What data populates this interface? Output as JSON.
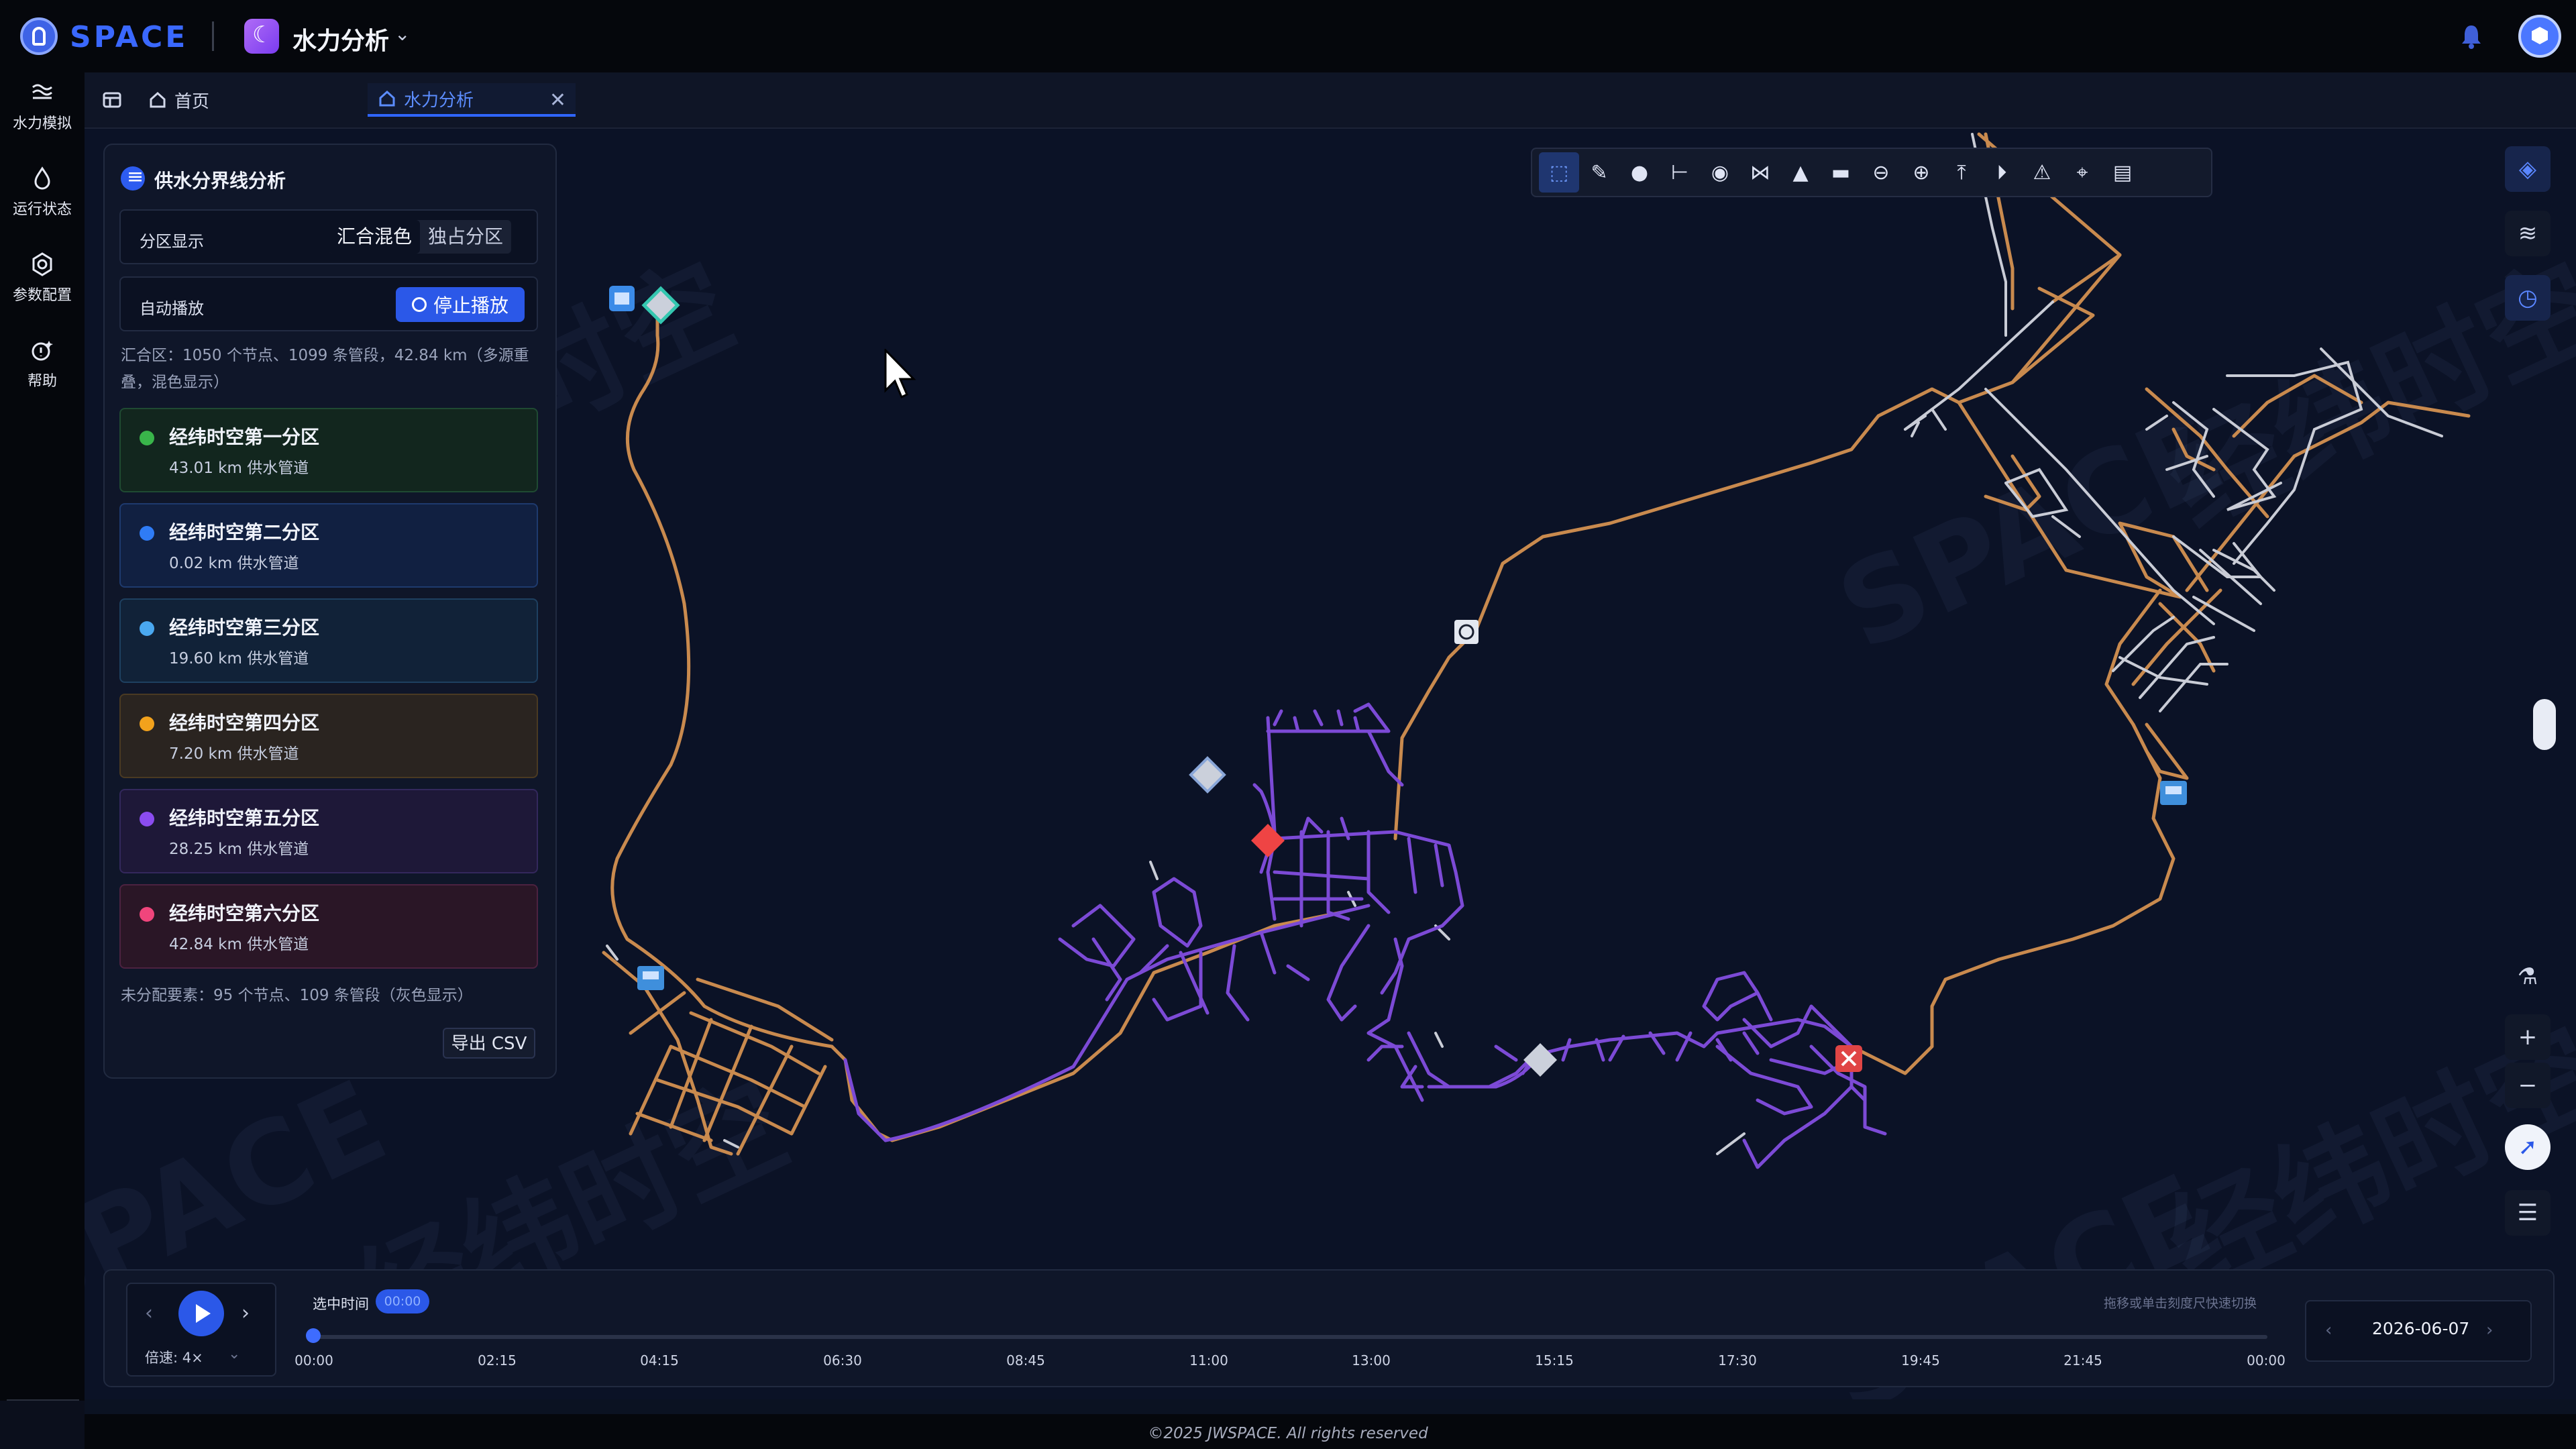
{
  "header": {
    "logo_text": "SPACE",
    "app_title": "水力分析",
    "colors": {
      "brand": "#3a68ff",
      "accent": "#2b58e8"
    }
  },
  "nav": {
    "items": [
      {
        "label": "水力模拟",
        "icon": "waves-icon"
      },
      {
        "label": "运行状态",
        "icon": "drop-icon"
      },
      {
        "label": "参数配置",
        "icon": "gear-icon"
      },
      {
        "label": "帮助",
        "icon": "help-icon"
      }
    ]
  },
  "tabs": {
    "home": "首页",
    "active": "水力分析"
  },
  "panel": {
    "title": "供水分界线分析",
    "display_label": "分区显示",
    "mode_blend": "汇合混色",
    "mode_exclusive": "独占分区",
    "autoplay_label": "自动播放",
    "stop_label": "停止播放",
    "summary": "汇合区：1050 个节点、1099 条管段，42.84 km（多源重叠，混色显示）",
    "zones": [
      {
        "name": "经纬时空第一分区",
        "length": "43.01 km 供水管道",
        "color": "#39b54a"
      },
      {
        "name": "经纬时空第二分区",
        "length": "0.02 km 供水管道",
        "color": "#2f7cf6"
      },
      {
        "name": "经纬时空第三分区",
        "length": "19.60 km 供水管道",
        "color": "#4aa8f0"
      },
      {
        "name": "经纬时空第四分区",
        "length": "7.20 km 供水管道",
        "color": "#f2a21c"
      },
      {
        "name": "经纬时空第五分区",
        "length": "28.25 km 供水管道",
        "color": "#8b4cf0"
      },
      {
        "name": "经纬时空第六分区",
        "length": "42.84 km 供水管道",
        "color": "#f0457c"
      }
    ],
    "unassigned": "未分配要素：95 个节点、109 条管段（灰色显示）",
    "export_label": "导出 CSV"
  },
  "map": {
    "watermark_a": "经纬时空",
    "watermark_b": "SPACE"
  },
  "timeline": {
    "selected_label": "选中时间",
    "selected_value": "00:00",
    "speed": "倍速: 4×",
    "hint": "拖移或单击刻度尺快速切换",
    "ticks": [
      "00:00",
      "02:15",
      "04:15",
      "06:30",
      "08:45",
      "11:00",
      "13:00",
      "15:15",
      "17:30",
      "19:45",
      "21:45",
      "00:00"
    ],
    "date": "2026-06-07"
  },
  "footer": {
    "copyright": "©2025 JWSPACE. All rights reserved"
  }
}
